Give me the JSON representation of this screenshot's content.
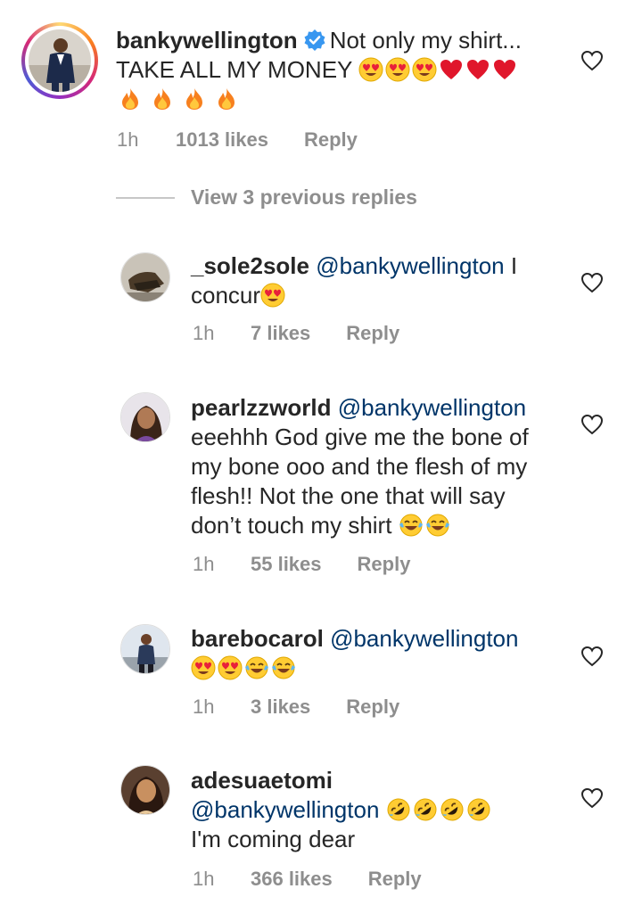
{
  "main_comment": {
    "username": "bankywellington",
    "verified": true,
    "text_line1": "Not only my shirt...",
    "text_line2": "TAKE ALL MY MONEY",
    "emojis_line2": [
      "heart-eyes",
      "heart-eyes",
      "heart-eyes",
      "red-heart",
      "red-heart",
      "red-heart"
    ],
    "emojis_line3": [
      "fire",
      "fire",
      "fire",
      "fire"
    ],
    "time": "1h",
    "likes": "1013 likes",
    "reply": "Reply"
  },
  "view_previous": "View 3 previous replies",
  "replies": [
    {
      "username": "_sole2sole",
      "mention": "@bankywellington",
      "text_a": "I",
      "text_b": "concur",
      "emojis": [
        "heart-eyes"
      ],
      "time": "1h",
      "likes": "7 likes",
      "reply": "Reply"
    },
    {
      "username": "pearlzzworld",
      "mention": "@bankywellington",
      "line2": "eeehhh God give me the bone of",
      "line3": "my bone ooo and the flesh of my",
      "line4": "flesh!! Not the one that will say",
      "line5": "don’t touch my shirt",
      "emojis": [
        "joy",
        "joy"
      ],
      "time": "1h",
      "likes": "55 likes",
      "reply": "Reply"
    },
    {
      "username": "barebocarol",
      "mention": "@bankywellington",
      "emojis": [
        "heart-eyes",
        "heart-eyes",
        "joy",
        "joy"
      ],
      "time": "1h",
      "likes": "3 likes",
      "reply": "Reply"
    },
    {
      "username": "adesuaetomi",
      "mention": "@bankywellington",
      "line3": "I'm coming dear",
      "emojis": [
        "rofl",
        "rofl",
        "rofl",
        "rofl"
      ],
      "time": "1h",
      "likes": "366 likes",
      "reply": "Reply"
    }
  ],
  "colors": {
    "text": "#262626",
    "meta": "#8e8e8e",
    "mention": "#003569",
    "verified": "#3897f0",
    "divider": "#c7c7c7"
  }
}
